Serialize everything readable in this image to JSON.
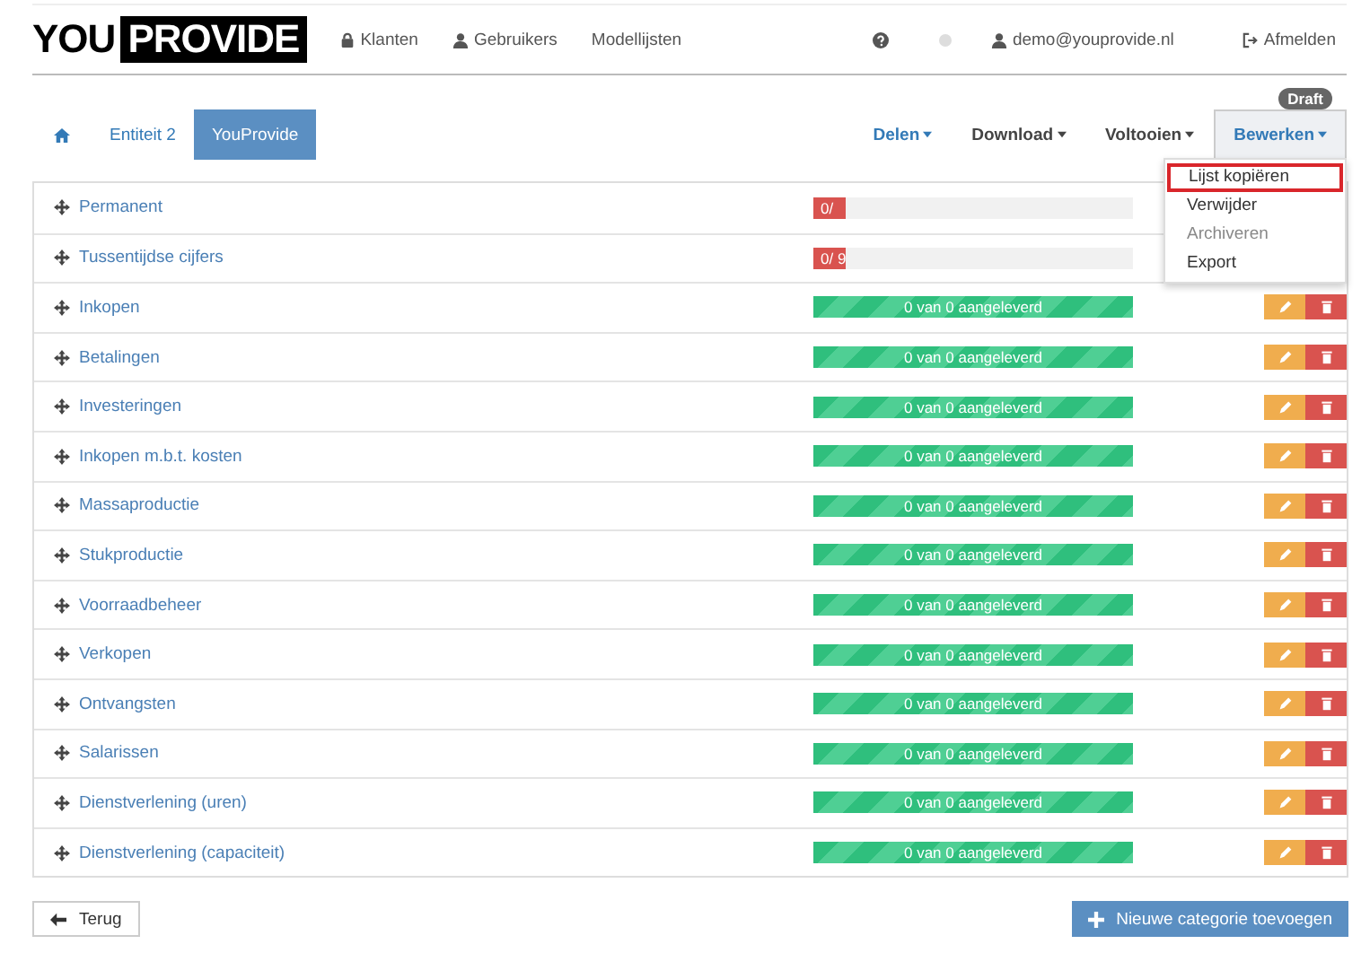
{
  "header": {
    "logo": {
      "left": "YOU",
      "right": "PROVIDE"
    },
    "nav": [
      {
        "label": "Klanten",
        "kind": "lock"
      },
      {
        "label": "Gebruikers",
        "kind": "user"
      },
      {
        "label": "Modellijsten",
        "kind": "plain"
      }
    ],
    "user": "demo@youprovide.nl",
    "logout": "Afmelden"
  },
  "tabs": [
    {
      "label": "Entiteit 2",
      "selected": false
    },
    {
      "label": "YouProvide",
      "selected": true
    }
  ],
  "actions": [
    {
      "label": "Delen",
      "emphasis": true,
      "open": false
    },
    {
      "label": "Download",
      "emphasis": false,
      "open": false
    },
    {
      "label": "Voltooien",
      "emphasis": false,
      "open": false
    },
    {
      "label": "Bewerken",
      "emphasis": false,
      "open": true
    }
  ],
  "badge": "Draft",
  "menu": [
    {
      "label": "Lijst kopiëren",
      "highlighted": true,
      "disabled": false
    },
    {
      "label": "Verwijder",
      "highlighted": false,
      "disabled": false
    },
    {
      "label": "Archiveren",
      "highlighted": false,
      "disabled": true
    },
    {
      "label": "Export",
      "highlighted": false,
      "disabled": false
    }
  ],
  "categories": [
    {
      "name": "Permanent",
      "buttons": false,
      "progress": {
        "kind": "partial",
        "level": 0.1,
        "text": "0/"
      }
    },
    {
      "name": "Tussentijdse cijfers",
      "buttons": false,
      "progress": {
        "kind": "partial",
        "level": 0.1,
        "text": "0/ 9"
      }
    },
    {
      "name": "Inkopen",
      "progress": {
        "kind": "complete",
        "level": 1,
        "text": "0 van 0 aangeleverd"
      }
    },
    {
      "name": "Betalingen",
      "progress": {
        "kind": "complete",
        "level": 1,
        "text": "0 van 0 aangeleverd"
      }
    },
    {
      "name": "Investeringen",
      "progress": {
        "kind": "complete",
        "level": 1,
        "text": "0 van 0 aangeleverd"
      }
    },
    {
      "name": "Inkopen m.b.t. kosten",
      "progress": {
        "kind": "complete",
        "level": 1,
        "text": "0 van 0 aangeleverd"
      }
    },
    {
      "name": "Massaproductie",
      "progress": {
        "kind": "complete",
        "level": 1,
        "text": "0 van 0 aangeleverd"
      }
    },
    {
      "name": "Stukproductie",
      "progress": {
        "kind": "complete",
        "level": 1,
        "text": "0 van 0 aangeleverd"
      }
    },
    {
      "name": "Voorraadbeheer",
      "progress": {
        "kind": "complete",
        "level": 1,
        "text": "0 van 0 aangeleverd"
      }
    },
    {
      "name": "Verkopen",
      "progress": {
        "kind": "complete",
        "level": 1,
        "text": "0 van 0 aangeleverd"
      }
    },
    {
      "name": "Ontvangsten",
      "progress": {
        "kind": "complete",
        "level": 1,
        "text": "0 van 0 aangeleverd"
      }
    },
    {
      "name": "Salarissen",
      "progress": {
        "kind": "complete",
        "level": 1,
        "text": "0 van 0 aangeleverd"
      }
    },
    {
      "name": "Dienstverlening (uren)",
      "progress": {
        "kind": "complete",
        "level": 1,
        "text": "0 van 0 aangeleverd"
      }
    },
    {
      "name": "Dienstverlening (capaciteit)",
      "progress": {
        "kind": "complete",
        "level": 1,
        "text": "0 van 0 aangeleverd"
      }
    }
  ],
  "footer": {
    "back": "Terug",
    "add": "Nieuwe categorie toevoegen"
  }
}
